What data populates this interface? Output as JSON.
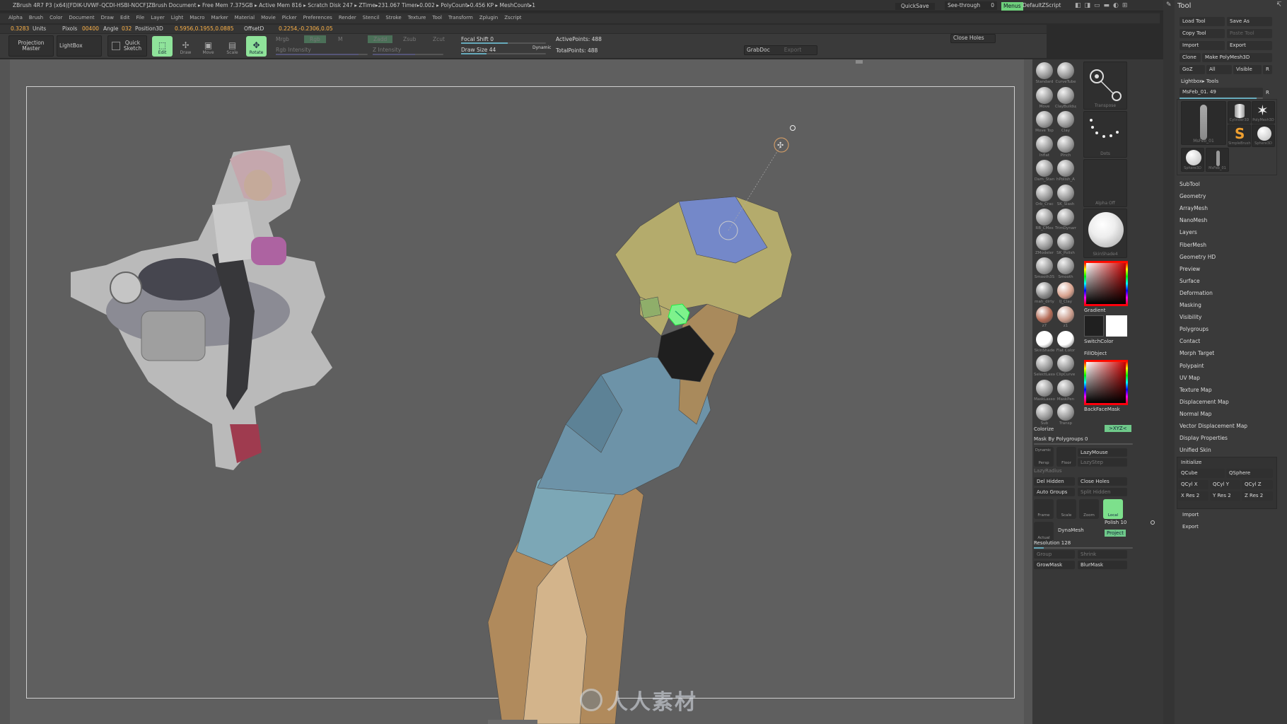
{
  "titlebar": {
    "text": "ZBrush 4R7 P3 (x64)[FDIK-UVWF-QCDI-HSBI-NOCF]ZBrush Document      ▸ Free Mem 7.375GB ▸ Active Mem 816 ▸ Scratch Disk 247 ▸ ZTime▸231.067 Timer▸0.002 ▸ PolyCount▸0.456 KP ▸ MeshCount▸1",
    "quicksave": "QuickSave",
    "seethrough": "See-through",
    "seethrough_value": "0",
    "menus": "Menus",
    "script": "DefaultZScript"
  },
  "menus": [
    "Alpha",
    "Brush",
    "Color",
    "Document",
    "Draw",
    "Edit",
    "File",
    "Layer",
    "Light",
    "Macro",
    "Marker",
    "Material",
    "Movie",
    "Picker",
    "Preferences",
    "Render",
    "Stencil",
    "Stroke",
    "Texture",
    "Tool",
    "Transform",
    "Zplugin",
    "Zscript"
  ],
  "status": {
    "units_val": "0.3283",
    "units": "Units",
    "pixols": "Pixols",
    "pixols_val": "00400",
    "angle": "Angle",
    "angle_val": "032",
    "position": "Position3D",
    "position_val": "0.5956,0.1955,0.0885",
    "offset": "OffsetD",
    "offset_val": "0.2254,-0.2306,0.05"
  },
  "shelf": {
    "projection_master": "Projection Master",
    "lightbox": "LightBox",
    "quick_sketch": "Quick Sketch",
    "edit": "Edit",
    "draw": "Draw",
    "move": "Move",
    "scale": "Scale",
    "rotate": "Rotate",
    "mrgb": "Mrgb",
    "rgb": "Rgb",
    "m": "M",
    "rgb_intensity": "Rgb Intensity",
    "zadd": "Zadd",
    "zsub": "Zsub",
    "zcut": "Zcut",
    "z_intensity": "Z Intensity",
    "focal_shift": "Focal Shift 0",
    "draw_size": "Draw Size 44",
    "dynamic": "Dynamic",
    "active_points": "ActivePoints: 488",
    "total_points": "TotalPoints: 488",
    "grabdoc": "GrabDoc",
    "export": "Export",
    "close_holes": "Close Holes"
  },
  "brush_palette": [
    {
      "label": "Standard"
    },
    {
      "label": "CurveTube"
    },
    {
      "label": "Move"
    },
    {
      "label": "ClayBuildup"
    },
    {
      "label": "Move Top"
    },
    {
      "label": "Clay"
    },
    {
      "label": "Inflat"
    },
    {
      "label": "Pinch"
    },
    {
      "label": "Dam_Stan"
    },
    {
      "label": "hPolish_A"
    },
    {
      "label": "Orb_Crac"
    },
    {
      "label": "SK_Slash"
    },
    {
      "label": "RB_CMes"
    },
    {
      "label": "TrimDynam"
    },
    {
      "label": "ZModeler"
    },
    {
      "label": "SK_Polish"
    },
    {
      "label": "Smooth3S"
    },
    {
      "label": "Smooth"
    },
    {
      "label": "mah_dirty"
    },
    {
      "label": "IJ_Clay"
    },
    {
      "label": "z7"
    },
    {
      "label": "z1"
    },
    {
      "label": "SkinShade"
    },
    {
      "label": "Flat Color"
    },
    {
      "label": "SelectLasso"
    },
    {
      "label": "ClipCurve"
    },
    {
      "label": "MaskLasso"
    },
    {
      "label": "MaskPen"
    },
    {
      "label": "Sub"
    },
    {
      "label": "Transp"
    }
  ],
  "tray_tiles": {
    "transpose": "Transpose",
    "dots": "Dots",
    "alpha": "Alpha Off",
    "material": "SkinShade4",
    "gradient": "Gradient",
    "switchcolor": "SwitchColor",
    "fillobject": "FillObject",
    "backfacemask": "BackFaceMask"
  },
  "tray_panel": {
    "colorize": "Colorize",
    "xyz": ">XYZ<",
    "mask_by_polygroups": "Mask By Polygroups 0",
    "dynamic": "Dynamic",
    "persp": "Persp",
    "floor": "Floor",
    "lazymouse": "LazyMouse",
    "lazystep": "LazyStep",
    "lazyradius": "LazyRadius",
    "del_hidden": "Del Hidden",
    "close_holes": "Close Holes",
    "auto_groups": "Auto Groups",
    "split_hidden": "Split Hidden",
    "local": "Local",
    "scale": "Scale",
    "zoom": "Zoom",
    "frame": "Frame",
    "actual": "Actual",
    "dynamesh": "DynaMesh",
    "polish": "Polish 10",
    "project": "Project",
    "resolution": "Resolution 128",
    "group": "Group",
    "shrink": "Shrink",
    "growmask": "GrowMask",
    "blurmask": "BlurMask"
  },
  "tool": {
    "title": "Tool",
    "load_tool": "Load Tool",
    "save_as": "Save As",
    "copy_tool": "Copy Tool",
    "paste_tool": "Paste Tool",
    "import": "Import",
    "export": "Export",
    "clone": "Clone",
    "make_polymesh": "Make PolyMesh3D",
    "goz": "GoZ",
    "all": "All",
    "visible": "Visible",
    "r": "R",
    "lightbox_tools": "Lightbox▸ Tools",
    "current_tool": "MsFeb_01. 49",
    "thumbs": [
      {
        "label": "MsFeb_01"
      },
      {
        "label": "Cylinder3D"
      },
      {
        "label": "PolyMesh3D"
      },
      {
        "label": "SimpleBrush"
      },
      {
        "label": "Sphere3D"
      },
      {
        "label": "Sphere3D"
      },
      {
        "label": "MsFeb_01"
      }
    ],
    "sections": [
      "SubTool",
      "Geometry",
      "ArrayMesh",
      "NanoMesh",
      "Layers",
      "FiberMesh",
      "Geometry HD",
      "Preview",
      "Surface",
      "Deformation",
      "Masking",
      "Visibility",
      "Polygroups",
      "Contact",
      "Morph Target",
      "Polypaint",
      "UV Map",
      "Texture Map",
      "Displacement Map",
      "Normal Map",
      "Vector Displacement Map",
      "Display Properties",
      "Unified Skin"
    ],
    "initialize": "Initialize",
    "qcube": "QCube",
    "qsphere": "QSphere",
    "qcyl_x": "QCyl X",
    "qcyl_y": "QCyl Y",
    "qcyl_z": "QCyl Z",
    "x_res": "X Res 2",
    "y_res": "Y Res 2",
    "z_res": "Z Res 2",
    "import2": "Import",
    "export2": "Export"
  },
  "watermark": "人人素材",
  "colors": {
    "bg": "#5f5f5f",
    "ui": "#383838",
    "accent": "#8fe39a",
    "model_yellow": "#b4ab6c",
    "model_blue": "#6d93a8",
    "model_tan": "#b08a5c"
  }
}
